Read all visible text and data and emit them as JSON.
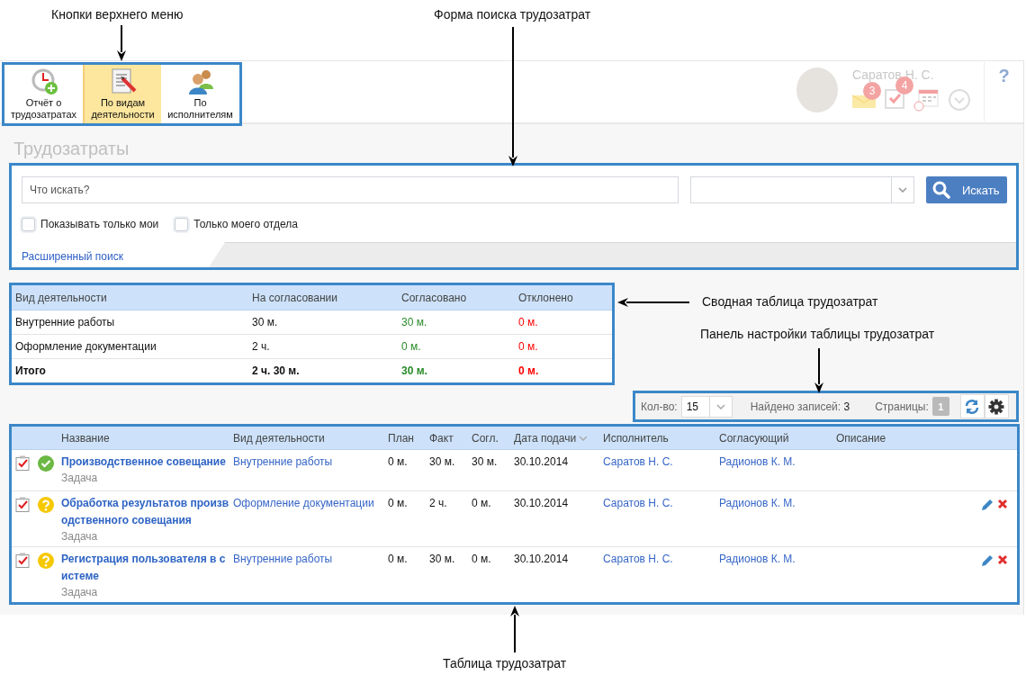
{
  "annotations": [
    {
      "text": "Кнопки верхнего меню"
    },
    {
      "text": "Форма поиска трудозатрат"
    },
    {
      "text": "Сводная таблица трудозатрат"
    },
    {
      "text": "Панель настройки таблицы трудозатрат"
    },
    {
      "text": "Таблица трудозатрат"
    }
  ],
  "toolbar": {
    "buttons": [
      {
        "label": "Отчёт о трудозатратах",
        "selected": false
      },
      {
        "label": "По видам деятельности",
        "selected": true
      },
      {
        "label": "По исполнителям",
        "selected": false
      }
    ]
  },
  "user": {
    "name": "Саратов Н. С.",
    "mail_count": "3",
    "task_count": "4"
  },
  "help": "?",
  "page_title": "Трудозатраты",
  "search": {
    "placeholder": "Что искать?",
    "button": "Искать",
    "options": [
      {
        "label": "Показывать только мои",
        "checked": false
      },
      {
        "label": "Только моего отдела",
        "checked": false
      }
    ],
    "advanced_link": "Расширенный поиск"
  },
  "summary": {
    "columns": [
      "Вид деятельности",
      "На согласовании",
      "Согласовано",
      "Отклонено"
    ],
    "rows": [
      {
        "kind": "item",
        "cells": [
          "Внутренние работы",
          "30 м.",
          "30 м.",
          "0 м."
        ]
      },
      {
        "kind": "item",
        "cells": [
          "Оформление документации",
          "2 ч.",
          "0 м.",
          "0 м."
        ]
      },
      {
        "kind": "total",
        "cells": [
          "Итого",
          "2 ч. 30 м.",
          "30 м.",
          "0 м."
        ]
      }
    ]
  },
  "panel": {
    "count_label": "Кол-во:",
    "count": "15",
    "found_label": "Найдено записей:",
    "found": "3",
    "pages_label": "Страницы:",
    "pages": [
      {
        "label": "1",
        "selected": true
      }
    ]
  },
  "table": {
    "columns": [
      {
        "label": "Название",
        "sorted": false
      },
      {
        "label": "Вид деятельности",
        "sorted": false
      },
      {
        "label": "План",
        "sorted": false
      },
      {
        "label": "Факт",
        "sorted": false
      },
      {
        "label": "Согл.",
        "sorted": false
      },
      {
        "label": "Дата подачи",
        "sorted": true
      },
      {
        "label": "Исполнитель",
        "sorted": false
      },
      {
        "label": "Согласующий",
        "sorted": false
      },
      {
        "label": "Описание",
        "sorted": false
      }
    ],
    "rows": [
      {
        "kind": "approved",
        "name": "Производственное совещание",
        "type": "Задача",
        "activity": "Внутренние работы",
        "plan": "0 м.",
        "fact": "30 м.",
        "approved": "30 м.",
        "date": "30.10.2014",
        "executor": "Саратов Н. С.",
        "approver": "Радионов К. М.",
        "editable": false
      },
      {
        "kind": "pending",
        "name": "Обработка результатов производственного совещания",
        "type": "Задача",
        "activity": "Оформление документации",
        "plan": "0 м.",
        "fact": "2 ч.",
        "approved": "0 м.",
        "date": "30.10.2014",
        "executor": "Саратов Н. С.",
        "approver": "Радионов К. М.",
        "editable": true
      },
      {
        "kind": "pending",
        "name": "Регистрация пользователя в системе",
        "type": "Задача",
        "activity": "Внутренние работы",
        "plan": "0 м.",
        "fact": "30 м.",
        "approved": "0 м.",
        "date": "30.10.2014",
        "executor": "Саратов Н. С.",
        "approver": "Радионов К. М.",
        "editable": true
      }
    ]
  }
}
